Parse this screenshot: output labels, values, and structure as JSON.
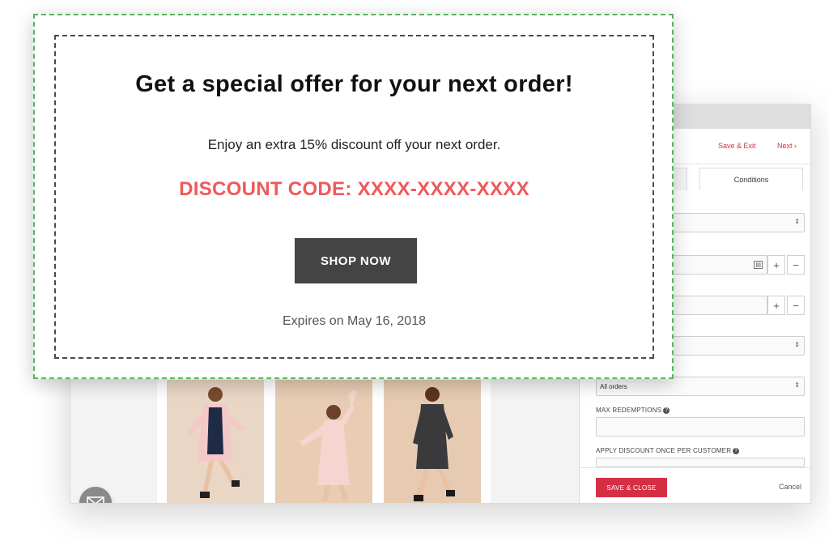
{
  "popup": {
    "title": "Get a special offer for your next order!",
    "subtitle": "Enjoy an extra 15% discount off your next order.",
    "code_line": "DISCOUNT CODE: XXXX-XXXX-XXXX",
    "shop_button": "SHOP NOW",
    "expiry": "Expires on May 16, 2018",
    "code_color": "#f0585a",
    "outer_border_color": "#58b65b"
  },
  "side_panel": {
    "save_exit": "Save & Exit",
    "next": "Next",
    "tabs": [
      "",
      "Conditions"
    ],
    "orders_select": "All orders",
    "max_redemptions_label": "MAX REDEMPTIONS",
    "apply_once_label": "APPLY DISCOUNT ONCE PER CUSTOMER",
    "save_close": "SAVE & CLOSE",
    "cancel": "Cancel",
    "accent_color": "#d52f45"
  },
  "icons": [
    "mail-icon",
    "chevron-right-icon",
    "select-caret-icon",
    "plus-icon",
    "minus-icon",
    "calendar-icon",
    "help-icon"
  ]
}
